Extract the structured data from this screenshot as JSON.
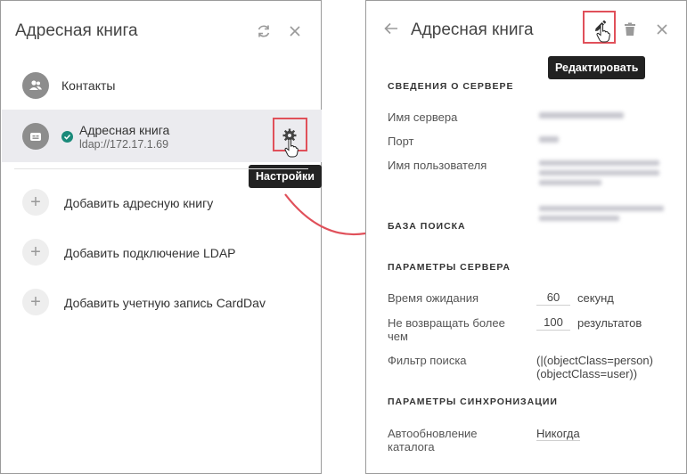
{
  "left": {
    "title": "Адресная книга",
    "items": [
      {
        "label": "Контакты",
        "icon": "contacts-icon"
      }
    ],
    "selected": {
      "label": "Адресная книга",
      "sublabel": "ldap://172.17.1.69",
      "status": "connected",
      "status_color": "#1a8a7a"
    },
    "settings_tooltip": "Настройки",
    "add_items": [
      {
        "label": "Добавить адресную книгу"
      },
      {
        "label": "Добавить подключение LDAP"
      },
      {
        "label": "Добавить учетную запись CardDav"
      }
    ]
  },
  "right": {
    "title": "Адресная книга",
    "edit_tooltip": "Редактировать",
    "server_section": "СВЕДЕНИЯ О СЕРВЕРЕ",
    "server_name_label": "Имя сервера",
    "port_label": "Порт",
    "username_label": "Имя пользователя",
    "search_base_section": "БАЗА ПОИСКА",
    "params_section": "ПАРАМЕТРЫ СЕРВЕРА",
    "timeout_label": "Время ожидания",
    "timeout_value": "60",
    "timeout_unit": "секунд",
    "max_label": "Не возвращать более чем",
    "max_value": "100",
    "max_unit": "результатов",
    "filter_label": "Фильтр поиска",
    "filter_value_line1": "(|(objectClass=person)",
    "filter_value_line2": "(objectClass=user))",
    "sync_section": "ПАРАМЕТРЫ СИНХРОНИЗАЦИИ",
    "autoupdate_label": "Автообновление каталога",
    "autoupdate_value": "Никогда"
  },
  "colors": {
    "accent_red": "#e0505a",
    "tooltip_bg": "#222222",
    "selected_bg": "#ebebef"
  }
}
